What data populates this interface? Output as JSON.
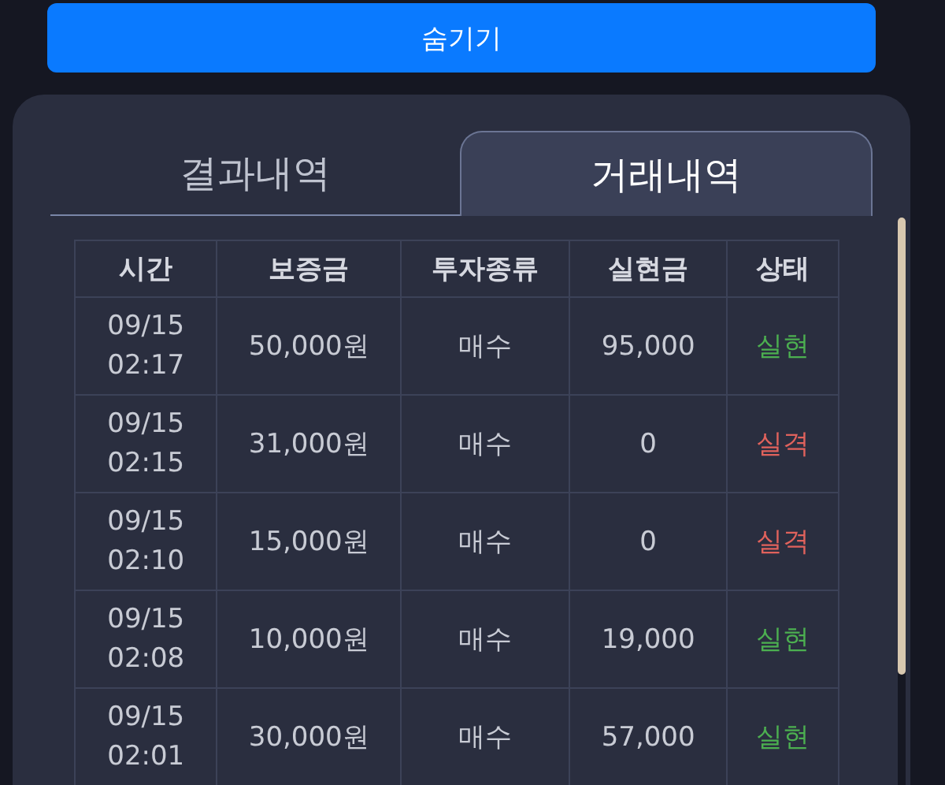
{
  "hide_button": {
    "label": "숨기기"
  },
  "tabs": [
    {
      "label": "결과내역",
      "selected": false
    },
    {
      "label": "거래내역",
      "selected": true
    }
  ],
  "table": {
    "columns": [
      "시간",
      "보증금",
      "투자종류",
      "실현금",
      "상태"
    ],
    "rows": [
      {
        "time": "09/15 02:17",
        "deposit": "50,000원",
        "type": "매수",
        "realized": "95,000",
        "status": "실현",
        "kind": "win"
      },
      {
        "time": "09/15 02:15",
        "deposit": "31,000원",
        "type": "매수",
        "realized": "0",
        "status": "실격",
        "kind": "loss"
      },
      {
        "time": "09/15 02:10",
        "deposit": "15,000원",
        "type": "매수",
        "realized": "0",
        "status": "실격",
        "kind": "loss"
      },
      {
        "time": "09/15 02:08",
        "deposit": "10,000원",
        "type": "매수",
        "realized": "19,000",
        "status": "실현",
        "kind": "win"
      },
      {
        "time": "09/15 02:01",
        "deposit": "30,000원",
        "type": "매수",
        "realized": "57,000",
        "status": "실현",
        "kind": "win"
      }
    ]
  }
}
